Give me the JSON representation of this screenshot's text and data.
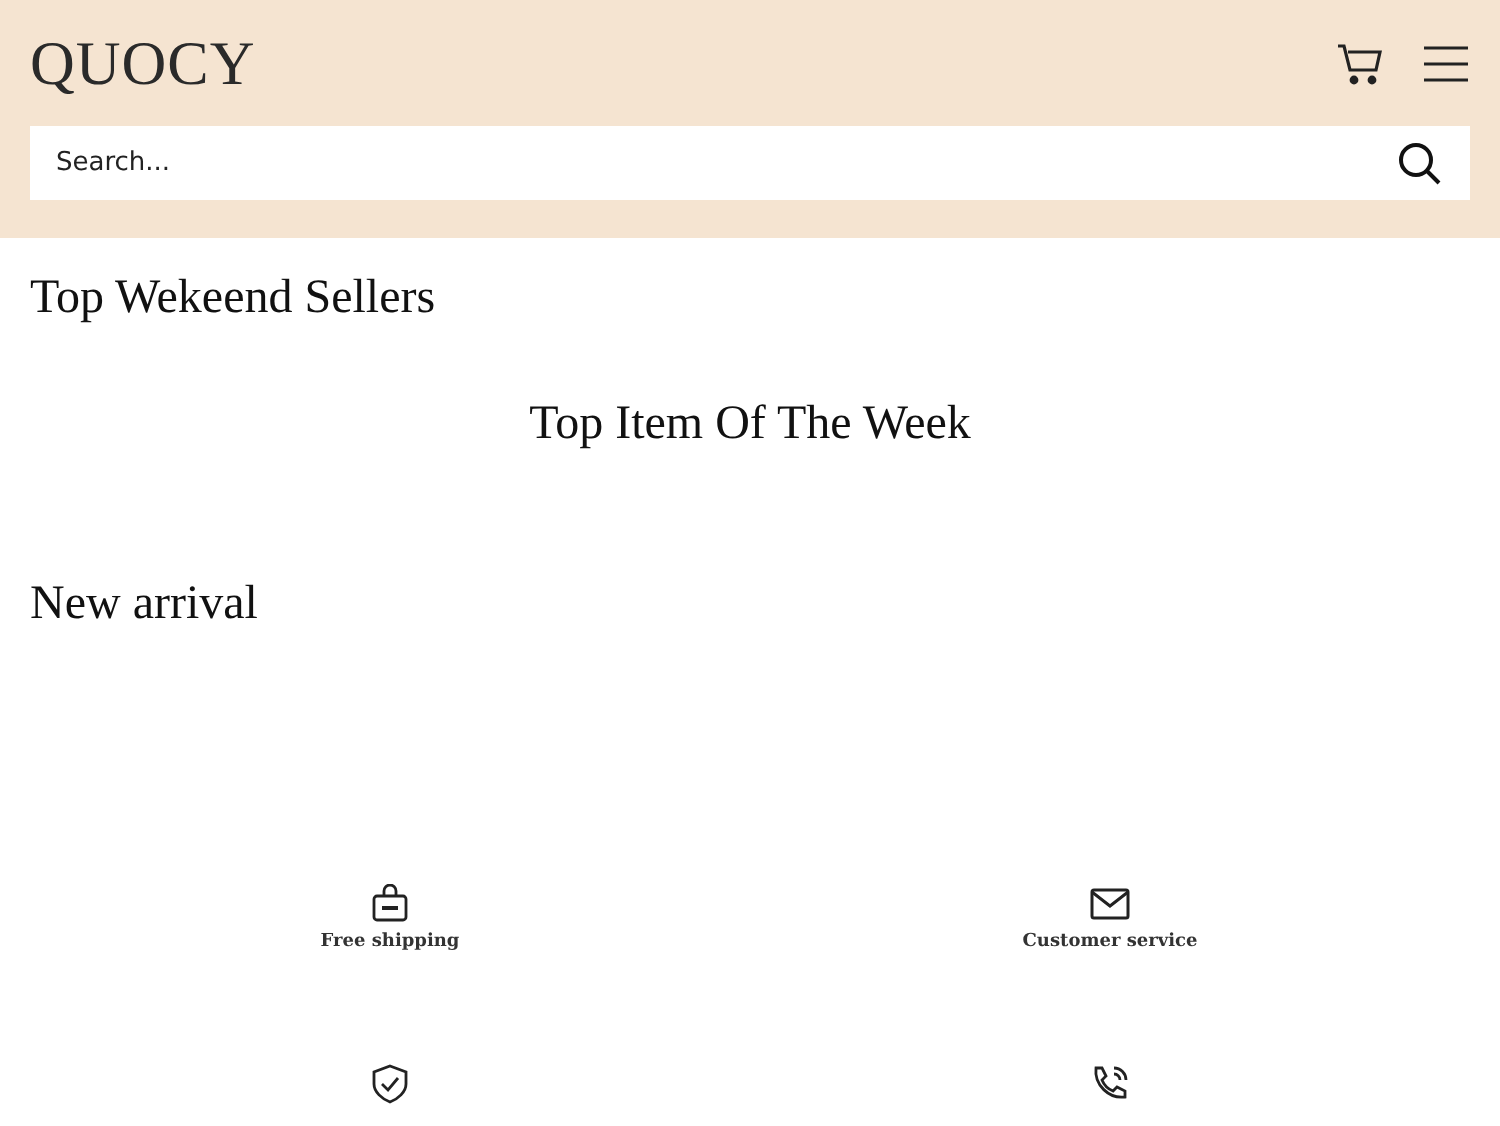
{
  "header": {
    "logo": "QUOCY",
    "search": {
      "placeholder": "Search..."
    }
  },
  "sections": [
    {
      "kind": "left",
      "title": "Top Wekeend Sellers"
    },
    {
      "kind": "center",
      "title": "Top Item Of The Week"
    },
    {
      "kind": "left",
      "title": "New arrival"
    }
  ],
  "features": [
    {
      "kind": "bag",
      "label": "Free shipping"
    },
    {
      "kind": "mail",
      "label": "Customer service"
    },
    {
      "kind": "shield"
    },
    {
      "kind": "phone"
    }
  ]
}
